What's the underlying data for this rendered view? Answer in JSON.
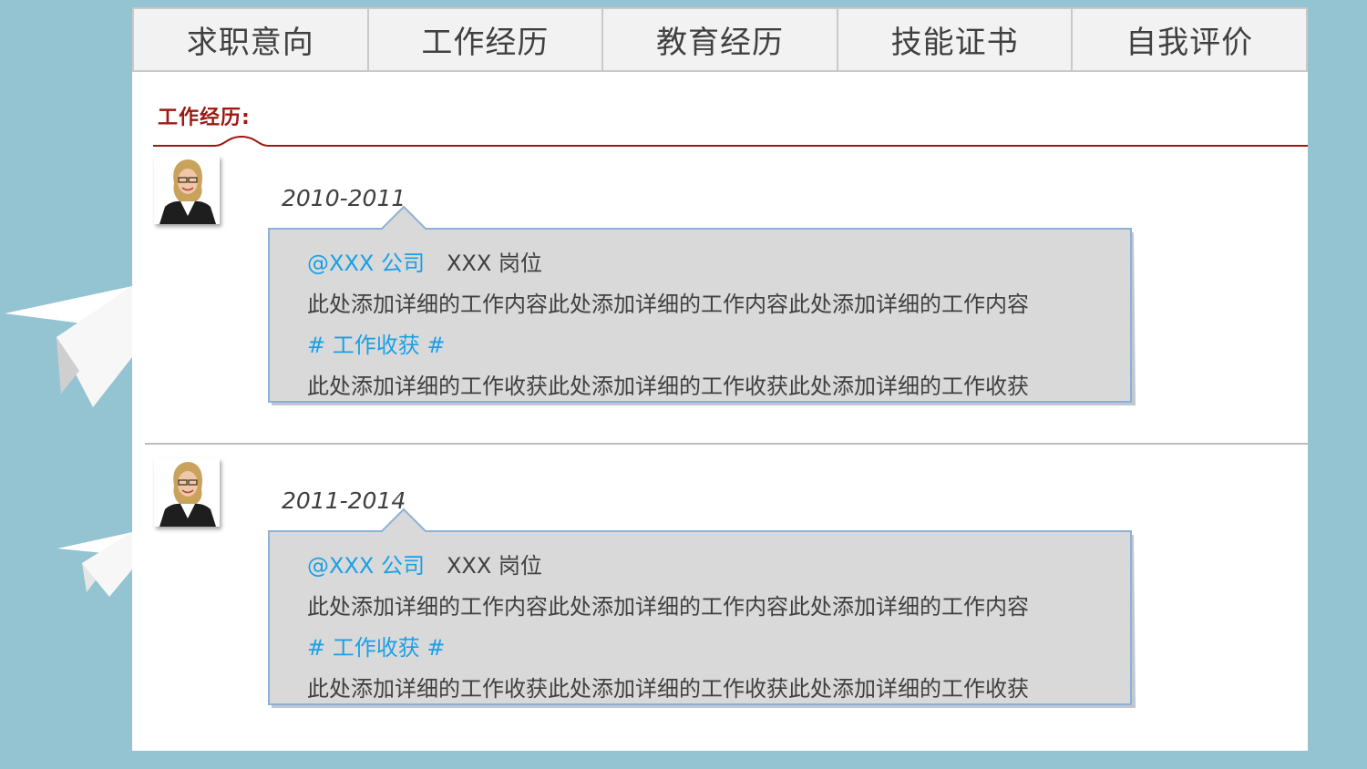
{
  "tabs": [
    "求职意向",
    "工作经历",
    "教育经历",
    "技能证书",
    "自我评价"
  ],
  "section": {
    "title": "工作经历:"
  },
  "entries": [
    {
      "date": "2010-2011",
      "company": "@XXX 公司",
      "position": "XXX 岗位",
      "content": "此处添加详细的工作内容此处添加详细的工作内容此处添加详细的工作内容",
      "harvest_label": "# 工作收获 #",
      "harvest": "此处添加详细的工作收获此处添加详细的工作收获此处添加详细的工作收获"
    },
    {
      "date": "2011-2014",
      "company": "@XXX 公司",
      "position": "XXX 岗位",
      "content": "此处添加详细的工作内容此处添加详细的工作内容此处添加详细的工作内容",
      "harvest_label": "# 工作收获 #",
      "harvest": "此处添加详细的工作收获此处添加详细的工作收获此处添加详细的工作收获"
    }
  ],
  "colors": {
    "background": "#94c3d1",
    "accent_red": "#9b1a14",
    "accent_blue": "#1aa0e6",
    "bubble_fill": "#d9d9d9",
    "bubble_border": "#8fb0d6"
  },
  "icons": {
    "decoration": "paper-plane-icon",
    "photo": "avatar-photo"
  }
}
